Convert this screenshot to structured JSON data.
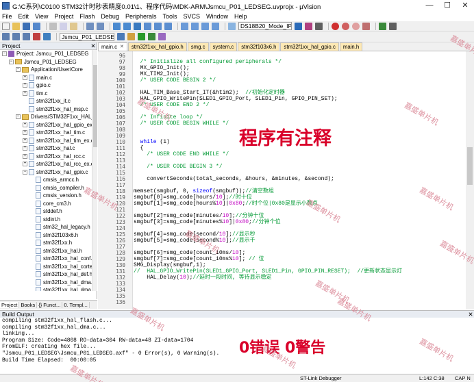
{
  "window": {
    "title": "G:\\C系列\\C0100 STM32计时秒表精度0.01\\1、程序代码\\MDK-ARM\\Jsmcu_P01_LEDSEG.uvprojx - µVision",
    "min": "—",
    "max": "☐",
    "close": "✕"
  },
  "menu": [
    "File",
    "Edit",
    "View",
    "Project",
    "Flash",
    "Debug",
    "Peripherals",
    "Tools",
    "SVCS",
    "Window",
    "Help"
  ],
  "toolbar": {
    "device_combo": "DS18B20_Mode_IPU",
    "target_combo": "Jsmcu_P01_LEDSEG"
  },
  "project_panel": {
    "title": "Project",
    "tree": [
      {
        "label": "Project: Jsmcu_P01_LEDSEG",
        "level": 0,
        "kind": "project",
        "toggle": "−"
      },
      {
        "label": "Jsmcu_P01_LEDSEG",
        "level": 1,
        "kind": "folder",
        "toggle": "−"
      },
      {
        "label": "Application/User/Core",
        "level": 2,
        "kind": "folder",
        "toggle": "−"
      },
      {
        "label": "main.c",
        "level": 3,
        "kind": "file",
        "toggle": "+"
      },
      {
        "label": "gpio.c",
        "level": 3,
        "kind": "file",
        "toggle": "+"
      },
      {
        "label": "tim.c",
        "level": 3,
        "kind": "file",
        "toggle": "+"
      },
      {
        "label": "stm32f1xx_it.c",
        "level": 3,
        "kind": "file",
        "toggle": ""
      },
      {
        "label": "stm32f1xx_hal_msp.c",
        "level": 3,
        "kind": "file",
        "toggle": ""
      },
      {
        "label": "Drivers/STM32F1xx_HAL_Dri",
        "level": 2,
        "kind": "folder",
        "toggle": "−"
      },
      {
        "label": "stm32f1xx_hal_gpio_ex.c",
        "level": 3,
        "kind": "file",
        "toggle": "+"
      },
      {
        "label": "stm32f1xx_hal_tim.c",
        "level": 3,
        "kind": "file",
        "toggle": "+"
      },
      {
        "label": "stm32f1xx_hal_tim_ex.c",
        "level": 3,
        "kind": "file",
        "toggle": "+"
      },
      {
        "label": "stm32f1xx_hal.c",
        "level": 3,
        "kind": "file",
        "toggle": "+"
      },
      {
        "label": "stm32f1xx_hal_rcc.c",
        "level": 3,
        "kind": "file",
        "toggle": "+"
      },
      {
        "label": "stm32f1xx_hal_rcc_ex.c",
        "level": 3,
        "kind": "file",
        "toggle": "+"
      },
      {
        "label": "stm32f1xx_hal_gpio.c",
        "level": 3,
        "kind": "file",
        "toggle": "−"
      },
      {
        "label": "cmsis_armcc.h",
        "level": 4,
        "kind": "file",
        "toggle": ""
      },
      {
        "label": "cmsis_compiler.h",
        "level": 4,
        "kind": "file",
        "toggle": ""
      },
      {
        "label": "cmsis_version.h",
        "level": 4,
        "kind": "file",
        "toggle": ""
      },
      {
        "label": "core_cm3.h",
        "level": 4,
        "kind": "file",
        "toggle": ""
      },
      {
        "label": "stddef.h",
        "level": 4,
        "kind": "file",
        "toggle": ""
      },
      {
        "label": "stdint.h",
        "level": 4,
        "kind": "file",
        "toggle": ""
      },
      {
        "label": "stm32_hal_legacy.h",
        "level": 4,
        "kind": "file",
        "toggle": ""
      },
      {
        "label": "stm32f103x6.h",
        "level": 4,
        "kind": "file",
        "toggle": ""
      },
      {
        "label": "stm32f1xx.h",
        "level": 4,
        "kind": "file",
        "toggle": ""
      },
      {
        "label": "stm32f1xx_hal.h",
        "level": 4,
        "kind": "file",
        "toggle": ""
      },
      {
        "label": "stm32f1xx_hal_conf.h",
        "level": 4,
        "kind": "file",
        "toggle": ""
      },
      {
        "label": "stm32f1xx_hal_cortex",
        "level": 4,
        "kind": "file",
        "toggle": ""
      },
      {
        "label": "stm32f1xx_hal_def.h",
        "level": 4,
        "kind": "file",
        "toggle": ""
      },
      {
        "label": "stm32f1xx_hal_dma.h",
        "level": 4,
        "kind": "file",
        "toggle": ""
      },
      {
        "label": "stm32f1xx_hal_dma_",
        "level": 4,
        "kind": "file",
        "toggle": ""
      },
      {
        "label": "stm32f1xx_hal_exti.h",
        "level": 4,
        "kind": "file",
        "toggle": ""
      }
    ],
    "tabs": [
      "Project",
      "Books",
      "{} Funct...",
      "0. Templ..."
    ]
  },
  "editor": {
    "tabs": [
      "main.c",
      "stm32f1xx_hal_gpio.h",
      "smg.c",
      "system.c",
      "stm32f103x6.h",
      "stm32f1xx_hal_gpio.c",
      "main.h"
    ],
    "active_tab": "main.c",
    "lines": [
      {
        "n": "96",
        "segs": []
      },
      {
        "n": "97",
        "segs": [
          {
            "t": "  /* Initialize all configured peripherals */",
            "c": "cmt"
          }
        ]
      },
      {
        "n": "98",
        "segs": [
          {
            "t": "  MX_GPIO_Init();",
            "c": ""
          }
        ]
      },
      {
        "n": "99",
        "segs": [
          {
            "t": "  MX_TIM2_Init();",
            "c": ""
          }
        ]
      },
      {
        "n": "100",
        "segs": [
          {
            "t": "  /* USER CODE BEGIN 2 */",
            "c": "cmt"
          }
        ]
      },
      {
        "n": "101",
        "segs": []
      },
      {
        "n": "102",
        "segs": [
          {
            "t": "  HAL_TIM_Base_Start_IT(&htim2);  ",
            "c": ""
          },
          {
            "t": "//初始化定时器",
            "c": "cmt"
          }
        ]
      },
      {
        "n": "103",
        "segs": [
          {
            "t": "  HAL_GPIO_WritePin(SLED1_GPIO_Port, SLED1_Pin, GPIO_PIN_SET);",
            "c": ""
          }
        ]
      },
      {
        "n": "104",
        "segs": [
          {
            "t": "  /* USER CODE END 2 */",
            "c": "cmt"
          }
        ]
      },
      {
        "n": "105",
        "segs": []
      },
      {
        "n": "106",
        "segs": [
          {
            "t": "  /* Infinite loop */",
            "c": "cmt"
          }
        ]
      },
      {
        "n": "107",
        "segs": [
          {
            "t": "  /* USER CODE BEGIN WHILE */",
            "c": "cmt"
          }
        ]
      },
      {
        "n": "108",
        "segs": []
      },
      {
        "n": "109",
        "segs": []
      },
      {
        "n": "110",
        "segs": [
          {
            "t": "  while",
            "c": "kw"
          },
          {
            "t": " (1)",
            "c": ""
          }
        ]
      },
      {
        "n": "111",
        "segs": [
          {
            "t": "  {",
            "c": ""
          }
        ]
      },
      {
        "n": "112",
        "segs": [
          {
            "t": "    /* USER CODE END WHILE */",
            "c": "cmt"
          }
        ]
      },
      {
        "n": "113",
        "segs": []
      },
      {
        "n": "114",
        "segs": [
          {
            "t": "    /* USER CODE BEGIN 3 */",
            "c": "cmt"
          }
        ]
      },
      {
        "n": "115",
        "segs": []
      },
      {
        "n": "116",
        "segs": [
          {
            "t": "    convertSeconds(total_seconds, &hours, &minutes, &second);",
            "c": ""
          }
        ]
      },
      {
        "n": "117",
        "segs": []
      },
      {
        "n": "118",
        "segs": [
          {
            "t": "memset(smgbuf, 0, ",
            "c": ""
          },
          {
            "t": "sizeof",
            "c": "kw"
          },
          {
            "t": "(smgbuf));",
            "c": ""
          },
          {
            "t": "//清空数组",
            "c": "cmt"
          }
        ]
      },
      {
        "n": "119",
        "segs": [
          {
            "t": "smgbuf[0]=smg_code[hours/",
            "c": ""
          },
          {
            "t": "10",
            "c": "cm"
          },
          {
            "t": "];",
            "c": ""
          },
          {
            "t": "//时十位",
            "c": "cmt"
          }
        ]
      },
      {
        "n": "120",
        "segs": [
          {
            "t": "smgbuf[1]=smg_code[hours%",
            "c": ""
          },
          {
            "t": "10",
            "c": "cm"
          },
          {
            "t": "]|",
            "c": ""
          },
          {
            "t": "0x80",
            "c": "cm"
          },
          {
            "t": ";",
            "c": ""
          },
          {
            "t": "//时个位|0x80是显示小数点",
            "c": "cmt"
          }
        ]
      },
      {
        "n": "121",
        "segs": []
      },
      {
        "n": "122",
        "segs": [
          {
            "t": "smgbuf[2]=smg_code[minutes/",
            "c": ""
          },
          {
            "t": "10",
            "c": "cm"
          },
          {
            "t": "];",
            "c": ""
          },
          {
            "t": "//分钟十位",
            "c": "cmt"
          }
        ]
      },
      {
        "n": "123",
        "segs": [
          {
            "t": "smgbuf[3]=smg_code[minutes%",
            "c": ""
          },
          {
            "t": "10",
            "c": "cm"
          },
          {
            "t": "]|",
            "c": ""
          },
          {
            "t": "0x80",
            "c": "cm"
          },
          {
            "t": ";",
            "c": ""
          },
          {
            "t": "//分钟个位",
            "c": "cmt"
          }
        ]
      },
      {
        "n": "124",
        "segs": []
      },
      {
        "n": "125",
        "segs": [
          {
            "t": "smgbuf[4]=smg_code[second/",
            "c": ""
          },
          {
            "t": "10",
            "c": "cm"
          },
          {
            "t": "];",
            "c": ""
          },
          {
            "t": "//显示秒",
            "c": "cmt"
          }
        ]
      },
      {
        "n": "126",
        "segs": [
          {
            "t": "smgbuf[5]=smg_code[second%",
            "c": ""
          },
          {
            "t": "10",
            "c": "cm"
          },
          {
            "t": "];",
            "c": ""
          },
          {
            "t": "//显示千",
            "c": "cmt"
          }
        ]
      },
      {
        "n": "127",
        "segs": []
      },
      {
        "n": "128",
        "segs": [
          {
            "t": "smgbuf[6]=smg_code[count_10ms/",
            "c": ""
          },
          {
            "t": "10",
            "c": "cm"
          },
          {
            "t": "];",
            "c": ""
          }
        ]
      },
      {
        "n": "129",
        "segs": [
          {
            "t": "smgbuf[7]=smg_code[count_10ms%",
            "c": ""
          },
          {
            "t": "10",
            "c": "cm"
          },
          {
            "t": "];",
            "c": ""
          },
          {
            "t": " // 位",
            "c": "cmt"
          }
        ]
      },
      {
        "n": "130",
        "segs": [
          {
            "t": "SMG_Display(smgbuf,1);",
            "c": ""
          }
        ]
      },
      {
        "n": "131",
        "segs": [
          {
            "t": "//  HAL_GPIO_WritePin(SLED1_GPIO_Port, SLED1_Pin, GPIO_PIN_RESET);  //更新状态显示灯",
            "c": "cmt"
          }
        ]
      },
      {
        "n": "132",
        "segs": [
          {
            "t": "    HAL_Delay(",
            "c": ""
          },
          {
            "t": "10",
            "c": "cm"
          },
          {
            "t": ");",
            "c": ""
          },
          {
            "t": "//延时一段时间, 等待显示稳定",
            "c": "cmt"
          }
        ]
      },
      {
        "n": "133",
        "segs": []
      },
      {
        "n": "134",
        "segs": []
      },
      {
        "n": "135",
        "segs": []
      },
      {
        "n": "136",
        "segs": []
      }
    ],
    "annotation": "程序有注释"
  },
  "build": {
    "title": "Build Output",
    "lines": [
      "compiling stm32f1xx_hal_flash.c...",
      "compiling stm32f1xx_hal_dma.c...",
      "linking...",
      "Program Size: Code=4808 RO-data=304 RW-data=48 ZI-data=1704",
      "FromELF: creating hex file...",
      "\"Jsmcu_P01_LEDSEG\\Jsmcu_P01_LEDSEG.axf\" - 0 Error(s), 0 Warning(s).",
      "Build Time Elapsed:  00:00:05"
    ],
    "annotation": "0错误 0警告"
  },
  "statusbar": {
    "debugger": "ST-Link Debugger",
    "position": "L:142 C:38",
    "caps": "CAP  N"
  },
  "watermark": "嘉盛单片机",
  "colors": {
    "comment": "#009933",
    "keyword": "#0000ff",
    "number": "#c000c0",
    "annotation": "#d9002a",
    "tab_bg": "#fde8b4"
  }
}
